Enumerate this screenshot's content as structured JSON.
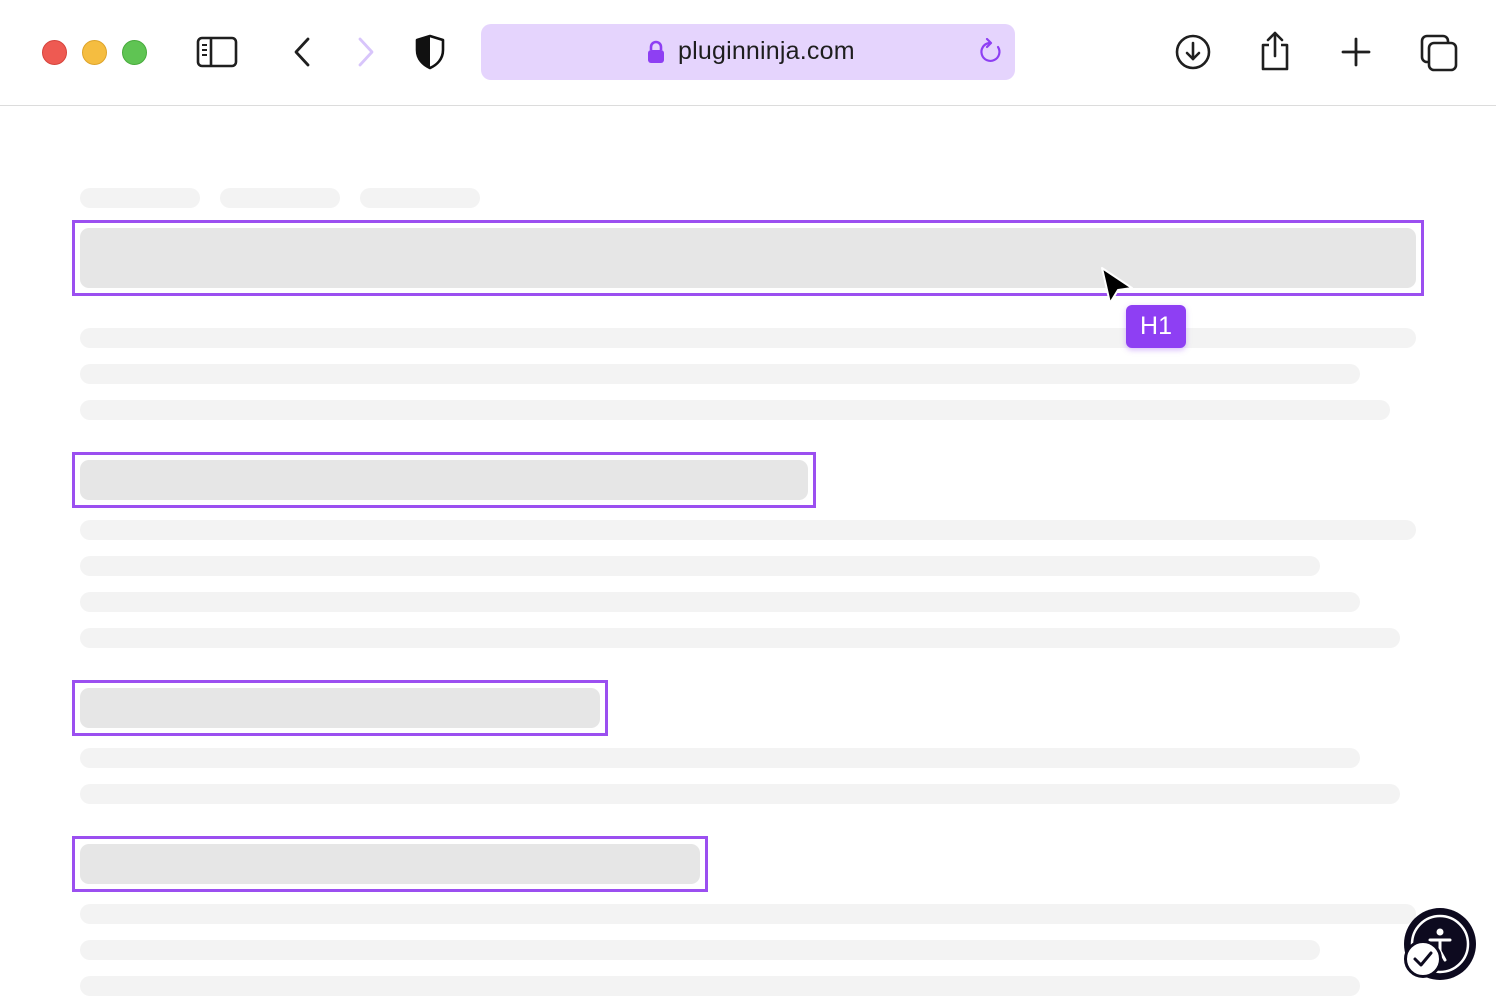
{
  "browser": {
    "url": "pluginninja.com",
    "accent_color": "#9b4ff0",
    "address_bar_color": "#e5d4fd"
  },
  "toolbar": {
    "icons": [
      "sidebar-icon",
      "back-icon",
      "forward-icon",
      "privacy-shield-icon",
      "download-icon",
      "share-icon",
      "new-tab-icon",
      "tab-overview-icon"
    ]
  },
  "page": {
    "heading_tag": "H1",
    "highlighted_headings": [
      "h1",
      "h2",
      "h2",
      "h2"
    ]
  },
  "widgets": {
    "accessibility_icon": "accessibility-icon",
    "status_icon": "checkmark-icon"
  }
}
